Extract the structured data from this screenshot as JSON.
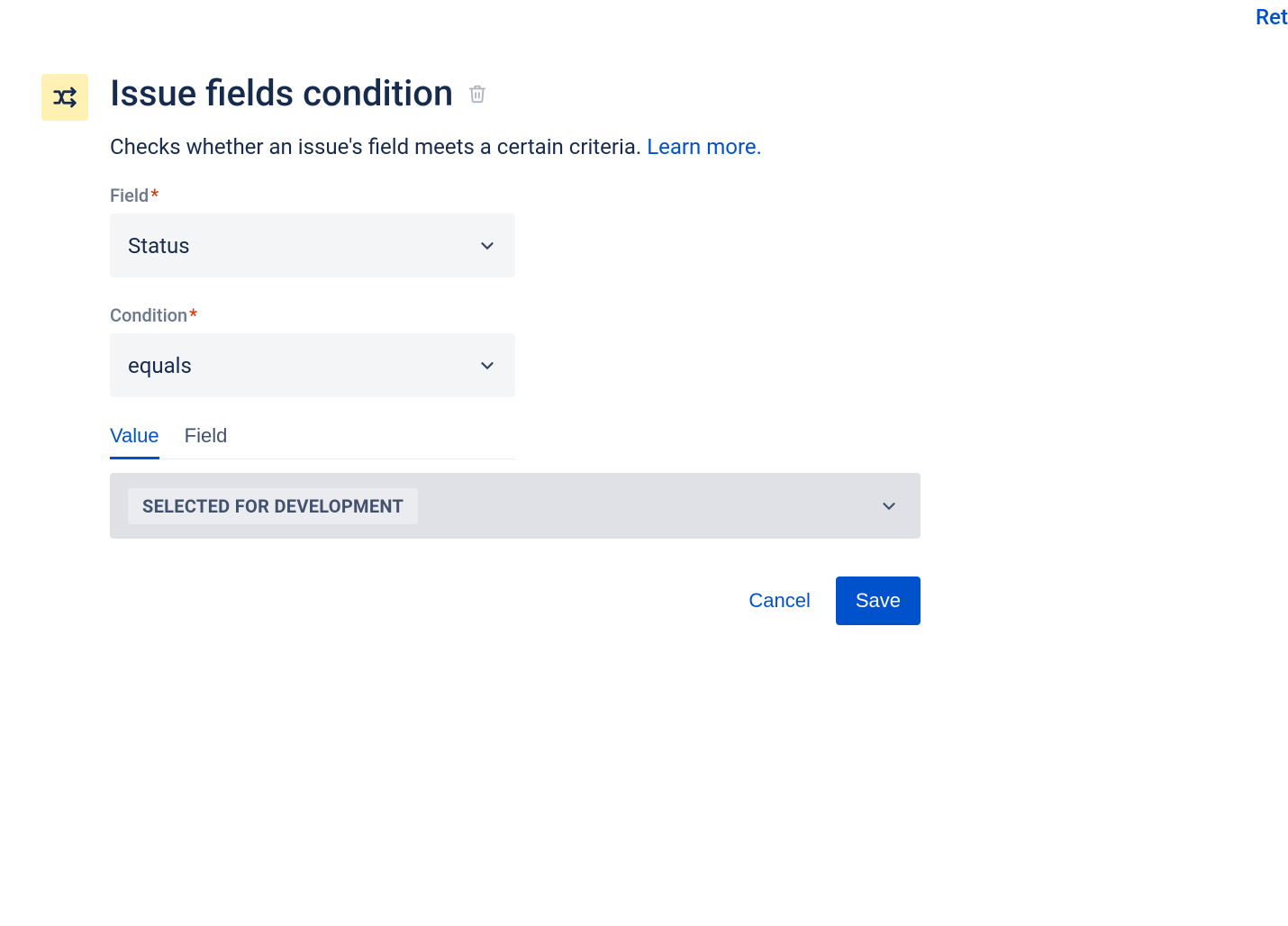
{
  "top_link_text": "Ret",
  "header": {
    "title": "Issue fields condition",
    "description": "Checks whether an issue's field meets a certain criteria. ",
    "learn_more_label": "Learn more."
  },
  "form": {
    "field_label": "Field",
    "field_value": "Status",
    "condition_label": "Condition",
    "condition_value": "equals",
    "tabs": {
      "value": "Value",
      "field": "Field"
    },
    "value_chip": "SELECTED FOR DEVELOPMENT"
  },
  "buttons": {
    "cancel": "Cancel",
    "save": "Save"
  }
}
